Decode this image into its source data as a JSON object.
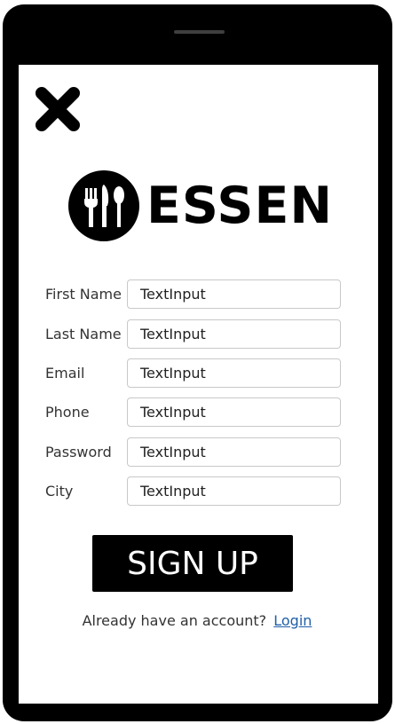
{
  "form": {
    "fields": [
      {
        "label": "First Name",
        "value": "TextInput"
      },
      {
        "label": "Last Name",
        "value": "TextInput"
      },
      {
        "label": "Email",
        "value": "TextInput"
      },
      {
        "label": "Phone",
        "value": "TextInput"
      },
      {
        "label": "Password",
        "value": "TextInput"
      },
      {
        "label": "City",
        "value": "TextInput"
      }
    ]
  },
  "brand": {
    "name": "ESSEN",
    "icon": "fork-knife-spoon-icon"
  },
  "actions": {
    "signup_label": "SIGN UP",
    "login_prompt": "Already have an account?",
    "login_label": "Login",
    "close_icon": "close-icon"
  },
  "colors": {
    "frame": "#000000",
    "screen": "#ffffff",
    "link": "#1f5fa8",
    "button": "#000000",
    "button_text": "#ffffff"
  }
}
